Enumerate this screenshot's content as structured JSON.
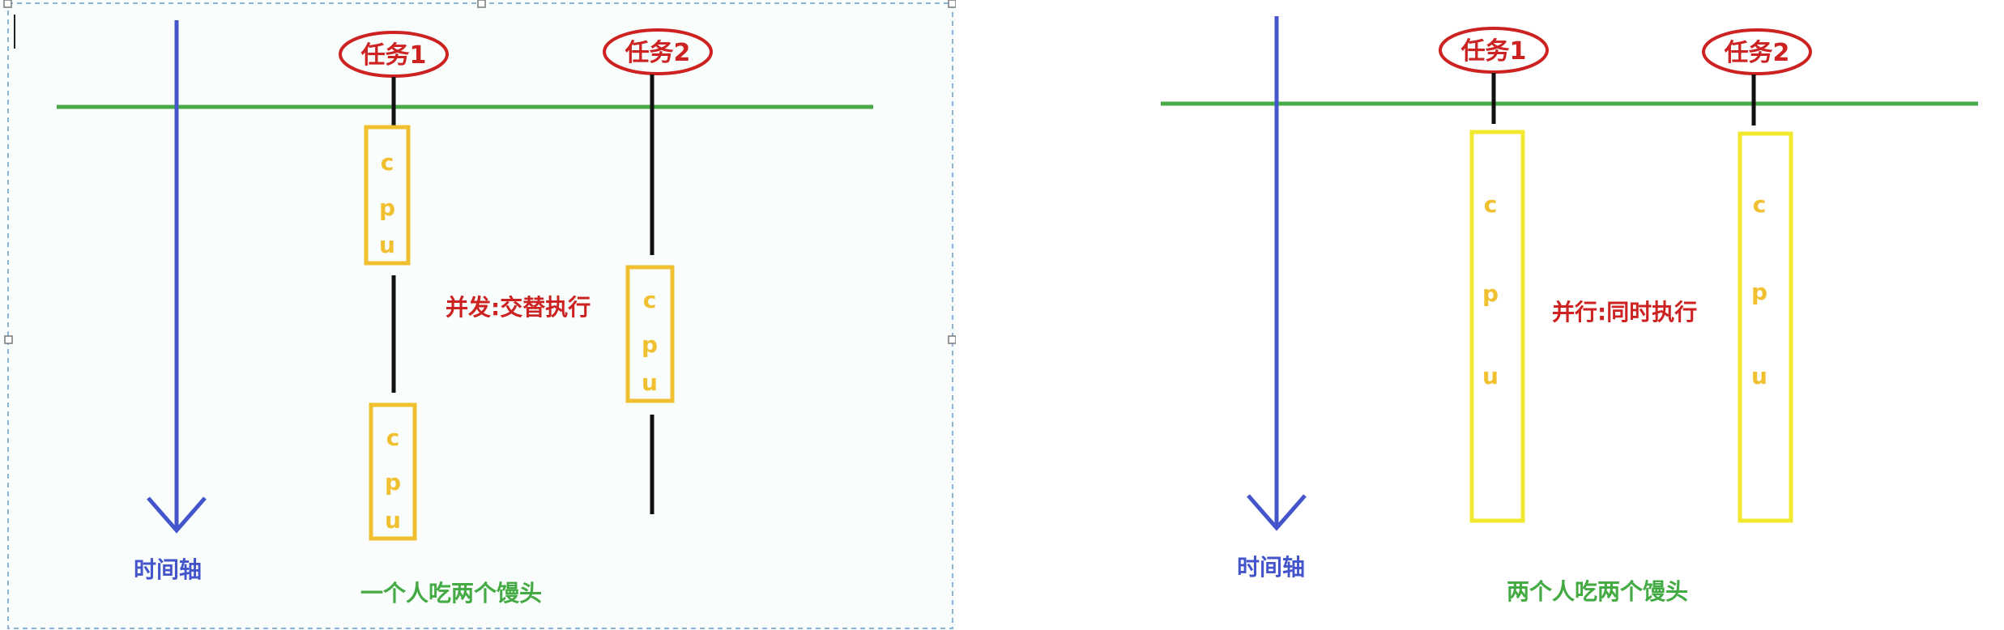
{
  "left": {
    "task1": "任务1",
    "task2": "任务2",
    "cpu_letters": [
      "c",
      "p",
      "u"
    ],
    "mode_label": "并发:交替执行",
    "timeline_label": "时间轴",
    "caption": "一个人吃两个馒头"
  },
  "right": {
    "task1": "任务1",
    "task2": "任务2",
    "cpu_letters": [
      "c",
      "p",
      "u"
    ],
    "mode_label": "并行:同时执行",
    "timeline_label": "时间轴",
    "caption": "两个人吃两个馒头"
  },
  "colors": {
    "timeline": "#4455cc",
    "baseline": "#4aaa4a",
    "task_ellipse": "#cc2222",
    "cpu_box_left": "#f0c030",
    "cpu_box_right": "#f2e830",
    "label_red": "#cc2222",
    "label_blue": "#4455cc",
    "label_green": "#44aa44"
  }
}
